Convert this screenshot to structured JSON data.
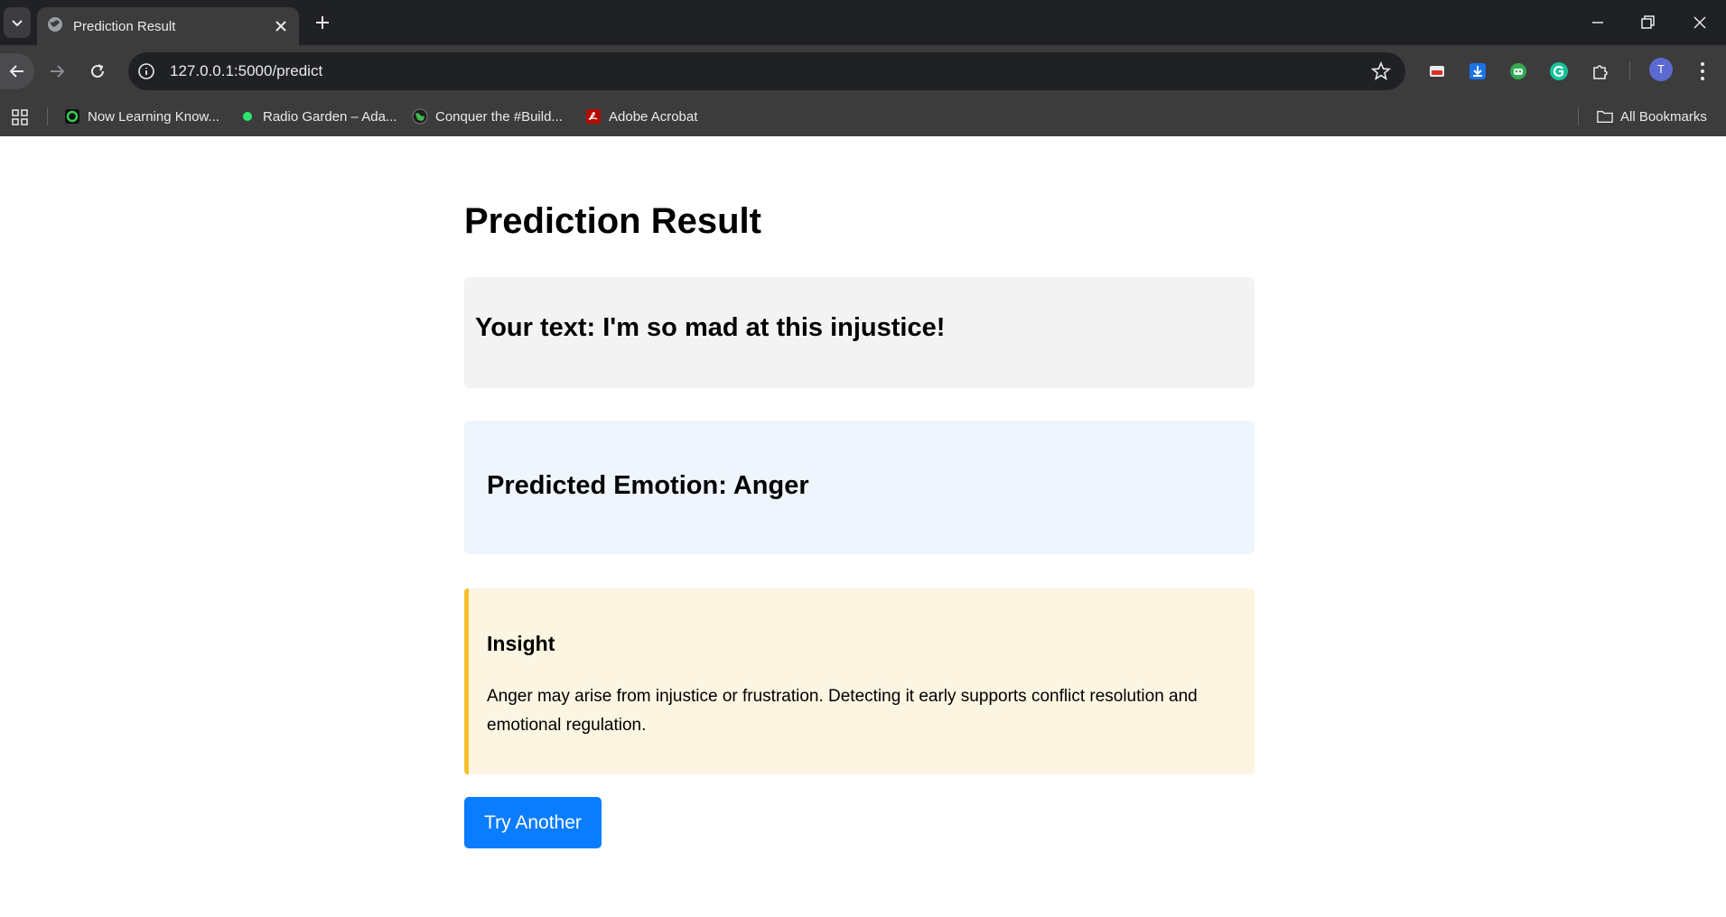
{
  "browser": {
    "tab": {
      "title": "Prediction Result",
      "favicon": "globe-icon"
    },
    "url": "127.0.0.1:5000/predict",
    "bookmarks": [
      {
        "label": "Now Learning Know...",
        "icon": "green-ring-icon"
      },
      {
        "label": "Radio Garden – Ada...",
        "icon": "green-dot-icon"
      },
      {
        "label": "Conquer the #Build...",
        "icon": "earth-icon"
      },
      {
        "label": "Adobe Acrobat",
        "icon": "acrobat-icon"
      }
    ],
    "all_bookmarks_label": "All Bookmarks",
    "profile_initial": "T"
  },
  "page": {
    "title": "Prediction Result",
    "input_line": "Your text: I'm so mad at this injustice!",
    "emotion_line": "Predicted Emotion: Anger",
    "insight": {
      "heading": "Insight",
      "body": "Anger may arise from injustice or frustration. Detecting it early supports conflict resolution and emotional regulation."
    },
    "button_label": "Try Another"
  },
  "colors": {
    "input_bg": "#f3f3f3",
    "emotion_bg": "#eef5fd",
    "insight_bg": "#fcf5e2",
    "insight_accent": "#f6c02c",
    "button_bg": "#0a7cff"
  }
}
